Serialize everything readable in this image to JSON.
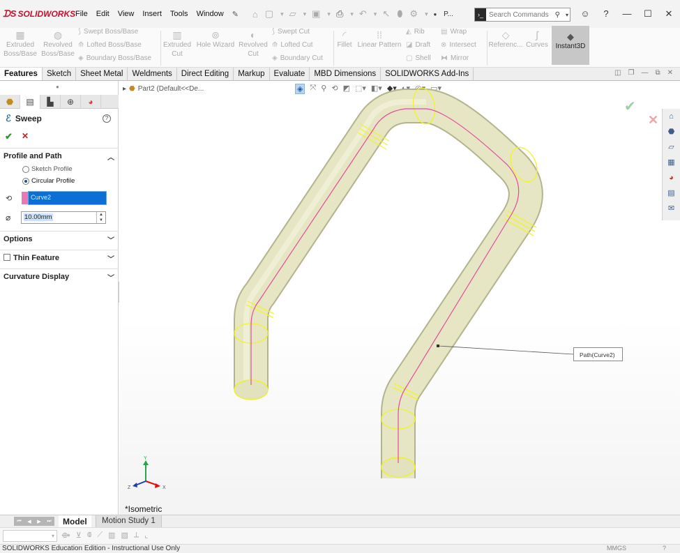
{
  "app": {
    "brand": "SOLIDWORKS"
  },
  "menu": [
    "File",
    "Edit",
    "View",
    "Insert",
    "Tools",
    "Window"
  ],
  "quick_access": {
    "extra_label": "P..."
  },
  "search": {
    "placeholder": "Search Commands"
  },
  "command_manager": {
    "extruded_boss": "Extruded Boss/Base",
    "revolved_boss": "Revolved Boss/Base",
    "swept_boss": "Swept Boss/Base",
    "lofted_boss": "Lofted Boss/Base",
    "boundary_boss": "Boundary Boss/Base",
    "extruded_cut": "Extruded Cut",
    "hole_wizard": "Hole Wizard",
    "revolved_cut": "Revolved Cut",
    "swept_cut": "Swept Cut",
    "lofted_cut": "Lofted Cut",
    "boundary_cut": "Boundary Cut",
    "fillet": "Fillet",
    "linear_pattern": "Linear Pattern",
    "rib": "Rib",
    "draft": "Draft",
    "shell": "Shell",
    "wrap": "Wrap",
    "intersect": "Intersect",
    "mirror": "Mirror",
    "reference": "Referenc...",
    "curves": "Curves",
    "instant3d": "Instant3D"
  },
  "tabs": [
    "Features",
    "Sketch",
    "Sheet Metal",
    "Weldments",
    "Direct Editing",
    "Markup",
    "Evaluate",
    "MBD Dimensions",
    "SOLIDWORKS Add-Ins"
  ],
  "property_manager": {
    "title": "Sweep",
    "help": "?",
    "profile_path": {
      "heading": "Profile and Path",
      "option_sketch": "Sketch Profile",
      "option_circular": "Circular Profile",
      "path_value": "Curve2",
      "diameter_value": "10.00mm"
    },
    "options_heading": "Options",
    "thin_feature_heading": "Thin Feature",
    "curvature_heading": "Curvature Display"
  },
  "graphics": {
    "tree_label": "Part2  (Default<<De...",
    "view_name": "*Isometric",
    "callout": "Path(Curve2)",
    "triad": {
      "x": "X",
      "y": "Y",
      "z": "Z"
    },
    "colors": {
      "tube": "#e6e6c4",
      "tube_edge": "#b8b893",
      "path": "#e04d9c",
      "silhouette": "#f5f52c"
    }
  },
  "bottom": {
    "tab_model": "Model",
    "tab_motion": "Motion Study 1"
  },
  "status": {
    "text": "SOLIDWORKS Education Edition - Instructional Use Only",
    "units": "MMGS"
  }
}
